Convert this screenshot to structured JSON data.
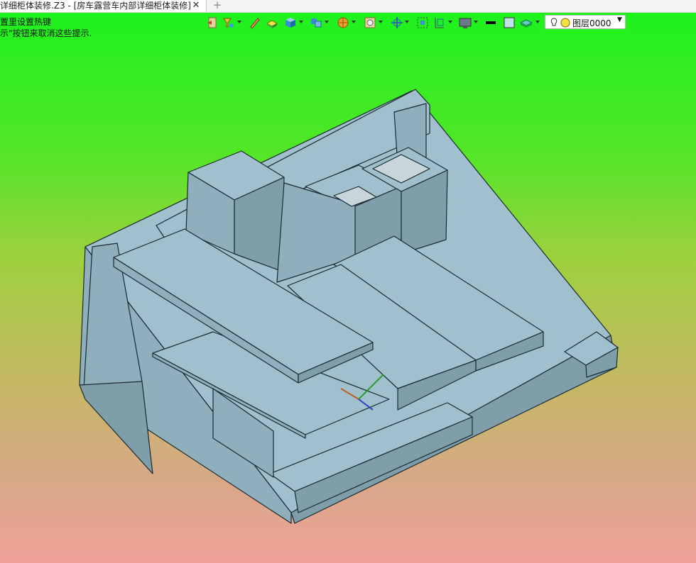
{
  "window": {
    "tab_title": "详细柜体装修.Z3 - [房车露营车内部详细柜体装修]",
    "close_glyph": "✕",
    "new_tab_glyph": "+"
  },
  "viewport": {
    "hint_line1": "置里设置热键",
    "hint_line2": "示\"按钮来取消这些提示."
  },
  "toolbar": {
    "icons": [
      "exit-icon",
      "filter-icon",
      "pen-icon",
      "box-select-icon",
      "cube-icon",
      "multi-view-icon",
      "render-style-icon",
      "zoom-icon",
      "orbit-icon",
      "fit-view-icon",
      "section-view-icon",
      "display-icon",
      "line-color-icon",
      "fill-color-icon",
      "layer-icon"
    ],
    "layer_value": "图层0000",
    "colors": {
      "line_color": "#000000",
      "fill_color": "#bfe3ee"
    }
  },
  "colors": {
    "viewport_top": "#1df21d",
    "viewport_bottom": "#efa198",
    "model_face": "#9fc0cc",
    "model_edge": "#1b2a30"
  }
}
